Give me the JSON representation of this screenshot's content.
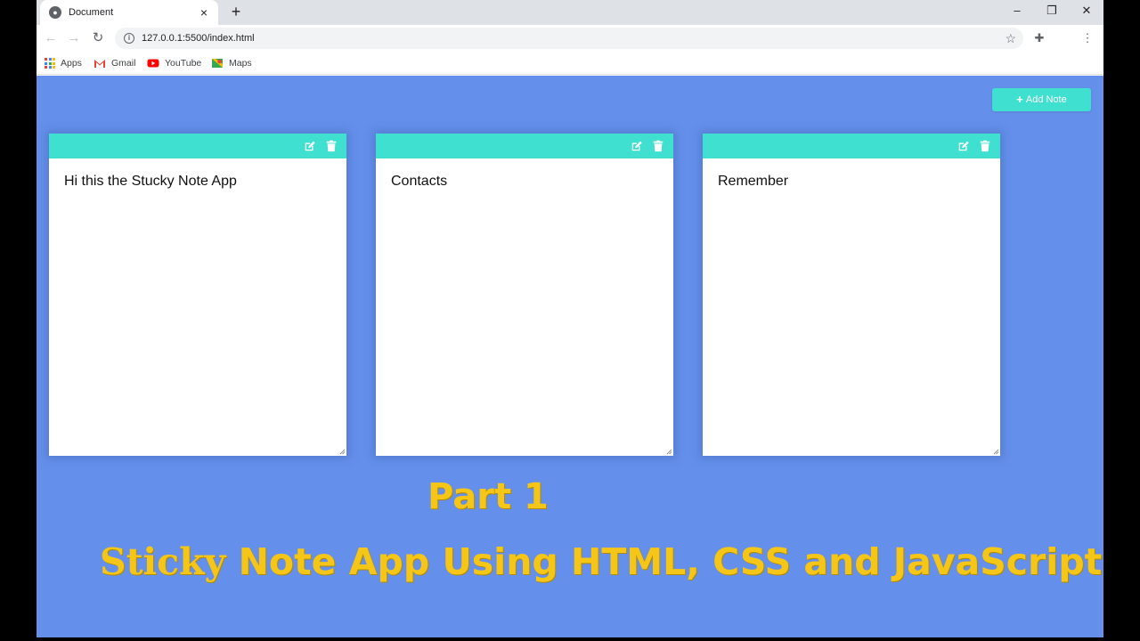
{
  "browser": {
    "tab_title": "Document",
    "tab_close": "×",
    "new_tab": "+",
    "window_controls": {
      "minimize": "–",
      "restore": "❐",
      "close": "✕"
    },
    "nav": {
      "back": "←",
      "forward": "→",
      "reload": "↻"
    },
    "url": "127.0.0.1:5500/index.html",
    "info_glyph": "i",
    "star_glyph": "☆",
    "extensions_glyph": "✚",
    "menu_glyph": "⋮",
    "bookmarks": [
      {
        "label": "Apps",
        "icon": "apps-grid-icon"
      },
      {
        "label": "Gmail",
        "icon": "gmail-icon"
      },
      {
        "label": "YouTube",
        "icon": "youtube-icon"
      },
      {
        "label": "Maps",
        "icon": "maps-icon"
      }
    ]
  },
  "app": {
    "background": "#6490ec",
    "accent": "#40e0d0",
    "add_note_label": "Add Note",
    "add_note_icon": "+",
    "notes": [
      {
        "text": "Hi this the Stucky Note App"
      },
      {
        "text": "Contacts"
      },
      {
        "text": "Remember"
      }
    ]
  },
  "overlay": {
    "part": "Part 1",
    "title_first": "Sticky",
    "title_rest": " Note App Using HTML, CSS and JavaScript",
    "color": "#f5c518"
  }
}
